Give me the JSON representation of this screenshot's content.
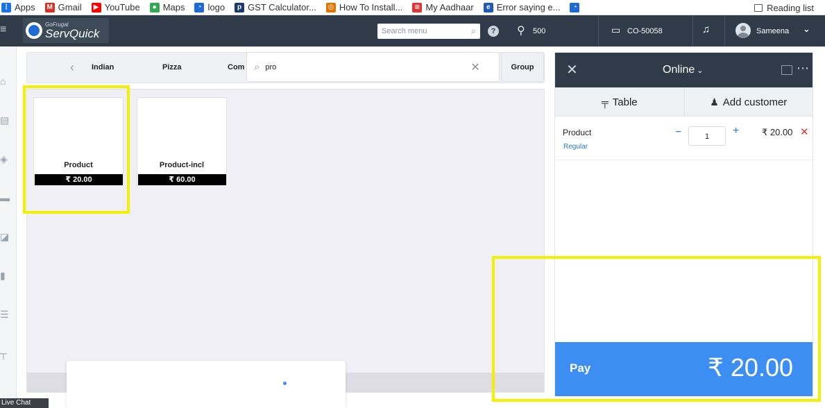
{
  "browser": {
    "bookmarks": [
      {
        "label": "Apps",
        "icon": "apps-grid-icon",
        "color": "#1a73e8"
      },
      {
        "label": "Gmail",
        "icon": "gmail-icon",
        "color": "#d93025"
      },
      {
        "label": "YouTube",
        "icon": "youtube-icon",
        "color": "#ff0000"
      },
      {
        "label": "Maps",
        "icon": "maps-icon",
        "color": "#34a853"
      },
      {
        "label": "logo",
        "icon": "gofrugal-icon",
        "color": "#1e6bd6"
      },
      {
        "label": "GST Calculator...",
        "icon": "pb-icon",
        "color": "#1b3a6b"
      },
      {
        "label": "How To Install...",
        "icon": "globe-icon",
        "color": "#e37400"
      },
      {
        "label": "My Aadhaar",
        "icon": "aadhaar-icon",
        "color": "#e23333"
      },
      {
        "label": "Error saying e...",
        "icon": "e-icon",
        "color": "#1e5bb8"
      }
    ],
    "reading_list": "Reading list"
  },
  "header": {
    "logo_small": "GoFrugal",
    "logo_big": "ServQuick",
    "search_placeholder": "Search menu",
    "location_count": "500",
    "counter": "CO-50058",
    "user": "Sameena"
  },
  "categories": {
    "items": [
      "Indian",
      "Pizza",
      "Com"
    ],
    "search_value": "pro",
    "group_label": "Group"
  },
  "products": [
    {
      "name": "Product",
      "price": "₹ 20.00"
    },
    {
      "name": "Product-incl",
      "price": "₹ 60.00"
    }
  ],
  "order": {
    "mode": "Online",
    "tabs": [
      {
        "label": "Table",
        "icon": "table-icon"
      },
      {
        "label": "Add customer",
        "icon": "add-customer-icon"
      }
    ],
    "items": [
      {
        "name": "Product",
        "variant": "Regular",
        "qty": "1",
        "price": "₹ 20.00"
      }
    ],
    "pay_label": "Pay",
    "pay_amount": "₹ 20.00"
  },
  "live_chat": "Live Chat",
  "colors": {
    "header_bg": "#2f3b48",
    "accent": "#3d8ef2",
    "highlight": "#f5f000",
    "price_bg": "#000000",
    "delete": "#e23333"
  }
}
